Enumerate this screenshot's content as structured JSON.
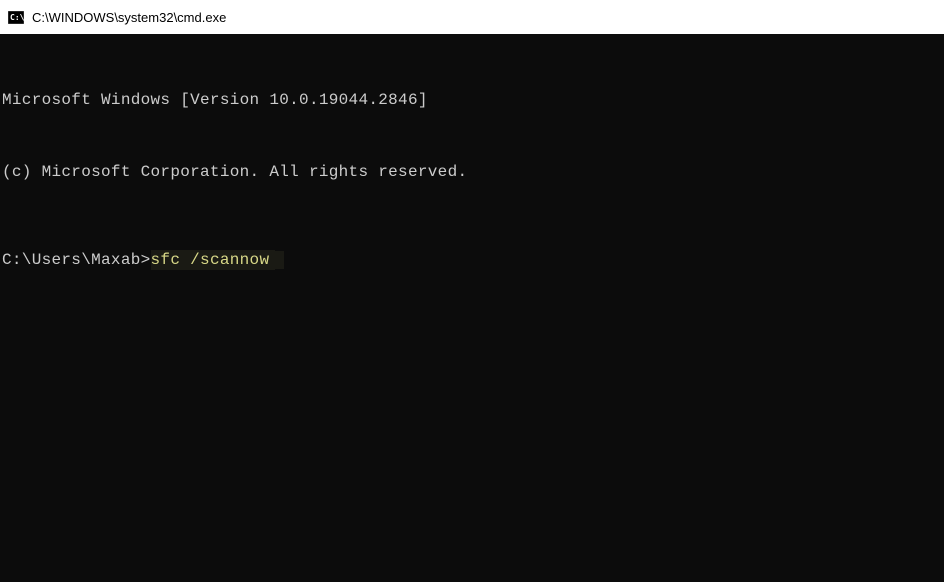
{
  "titlebar": {
    "title": "C:\\WINDOWS\\system32\\cmd.exe"
  },
  "terminal": {
    "line1": "Microsoft Windows [Version 10.0.19044.2846]",
    "line2": "(c) Microsoft Corporation. All rights reserved.",
    "prompt": "C:\\Users\\Maxab>",
    "command": "sfc /scannow"
  }
}
